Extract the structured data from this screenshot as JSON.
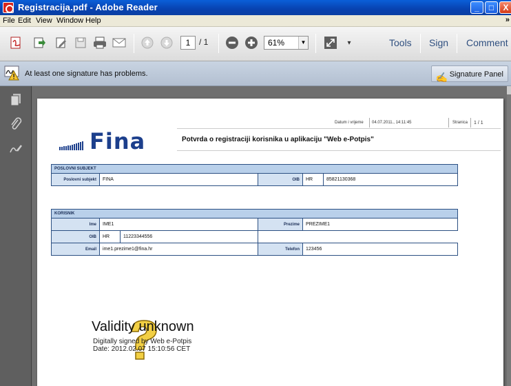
{
  "window": {
    "title": "Registracija.pdf - Adobe Reader",
    "controls": {
      "minimize": "_",
      "maximize": "□",
      "close": "X"
    }
  },
  "menu": {
    "items": [
      "File",
      "Edit",
      "View",
      "Window",
      "Help"
    ],
    "overflow": "»"
  },
  "toolbar": {
    "page_current": "1",
    "page_total": "/ 1",
    "zoom": "61%",
    "links": [
      "Tools",
      "Sign",
      "Comment"
    ],
    "icons": [
      "create-pdf-icon",
      "export-icon",
      "edit-icon",
      "save-icon",
      "print-icon",
      "email-icon",
      "prev-page-icon",
      "next-page-icon",
      "zoom-out-icon",
      "zoom-in-icon",
      "fit-page-icon"
    ]
  },
  "signature_bar": {
    "message": "At least one signature has problems.",
    "panel_button": "Signature Panel"
  },
  "document": {
    "header": {
      "date_label": "Datum i vrijeme",
      "date_value": "04.07.2011., 14:11:45",
      "page_label": "Stranica",
      "page_value": "1 / 1"
    },
    "logo_text": "Fina",
    "title": "Potvrda o registraciji korisnika u aplikaciju \"Web e-Potpis\"",
    "section1": {
      "heading": "POSLOVNI SUBJEKT",
      "label_subject": "Poslovni subjekt",
      "value_subject": "FINA",
      "label_oib": "OIB",
      "value_country": "HR",
      "value_oib": "85821130368"
    },
    "section2": {
      "heading": "KORISNIK",
      "label_ime": "Ime",
      "value_ime": "IME1",
      "label_prezime": "Prezime",
      "value_prezime": "PREZIME1",
      "label_oib": "OIB",
      "value_country": "HR",
      "value_oib": "11223344556",
      "label_email": "Email",
      "value_email": "ime1.prezime1@fina.hr",
      "label_telefon": "Telefon",
      "value_telefon": "123456"
    },
    "signature": {
      "status": "Validity unknown",
      "signed_by": "Digitally signed by Web e-Potpis",
      "date": "Date: 2012.02.07 15:10:56 CET"
    }
  },
  "colors": {
    "titlebar": "#0842b0",
    "table_header": "#b9d0ea",
    "table_border": "#2b4f82",
    "fina_blue": "#1c3f8c"
  }
}
